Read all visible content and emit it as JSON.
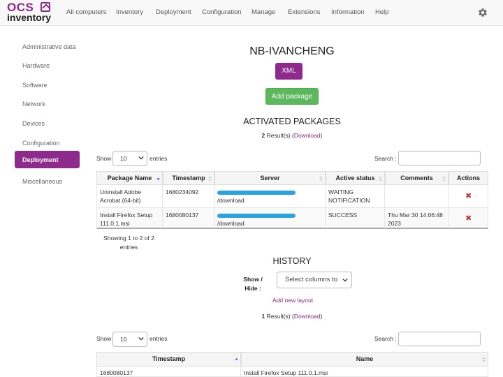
{
  "nav": {
    "logo_top": "OCS",
    "logo_bottom": "inventory",
    "items": [
      "All computers",
      "Inventory",
      "Deployment",
      "Configuration",
      "Manage",
      "Extensions",
      "Information",
      "Help"
    ],
    "settings_icon": "gear-icon"
  },
  "sidebar": {
    "items": [
      "Administrative data",
      "Hardware",
      "Software",
      "Network",
      "Devices",
      "Configuration",
      "Deployment",
      "Miscellaneous"
    ],
    "active": "Deployment"
  },
  "page": {
    "title": "NB-IVANCHENG",
    "xml_label": "XML",
    "add_package_label": "Add package"
  },
  "activated": {
    "title": "ACTIVATED PACKAGES",
    "result_count": "2",
    "result_suffix": " Result(s) (",
    "download_label": "Download",
    "result_close": ")",
    "show_label": "Show",
    "show_value": "10",
    "entries_label": "entries",
    "search_label": "Search :",
    "columns": [
      "Package Name",
      "Timestamp",
      "Server",
      "Active status",
      "Comments",
      "Actions"
    ],
    "rows": [
      {
        "name": "Uninstall Adobe Acrobat (64-bit)",
        "timestamp": "1680234092",
        "server_suffix": "/download",
        "status": "WAITING NOTIFICATION",
        "comments": ""
      },
      {
        "name": "Install Firefox Setup 111.0.1.msi",
        "timestamp": "1680080137",
        "server_suffix": "/download",
        "status": "SUCCESS",
        "comments": "Thu Mar 30 14:06:48 2023"
      }
    ],
    "showing": "Showing 1 to 2 of 2 entries"
  },
  "history": {
    "title": "HISTORY",
    "showhide_label": "Show / Hide :",
    "columns_placeholder": "Select columns to",
    "add_layout_label": "Add new layout",
    "result_count": "1",
    "result_suffix": " Result(s) (",
    "download_label": "Download",
    "result_close": ")",
    "show_label": "Show",
    "show_value": "10",
    "entries_label": "entries",
    "search_label": "Search :",
    "columns": [
      "Timestamp",
      "Name"
    ],
    "rows": [
      {
        "timestamp": "1680080137",
        "name": "Install Firefox Setup 111.0.1.msi"
      }
    ]
  },
  "colors": {
    "brand": "#8e2a8b",
    "success": "#5cb85c",
    "danger": "#c0392b"
  }
}
